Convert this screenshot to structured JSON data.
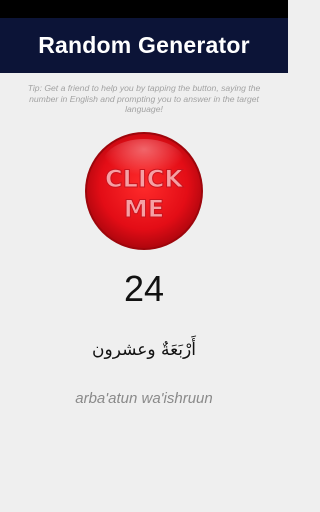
{
  "app": {
    "title": "Random Generator"
  },
  "tip": {
    "text": "Tip: Get a friend to help you by tapping the button, saying the number in English and prompting you to answer in the target language!"
  },
  "button": {
    "line1": "CLICK",
    "line2": "ME"
  },
  "result": {
    "number": "24",
    "arabic": "أَرْبَعَةٌ وعشرون",
    "transliteration": "arba'atun wa'ishruun"
  },
  "colors": {
    "app_bar": "#0c1437",
    "status_bar": "#000000",
    "background": "#efefef",
    "button_red": "#e8101c",
    "button_text": "#f6a0a4"
  }
}
